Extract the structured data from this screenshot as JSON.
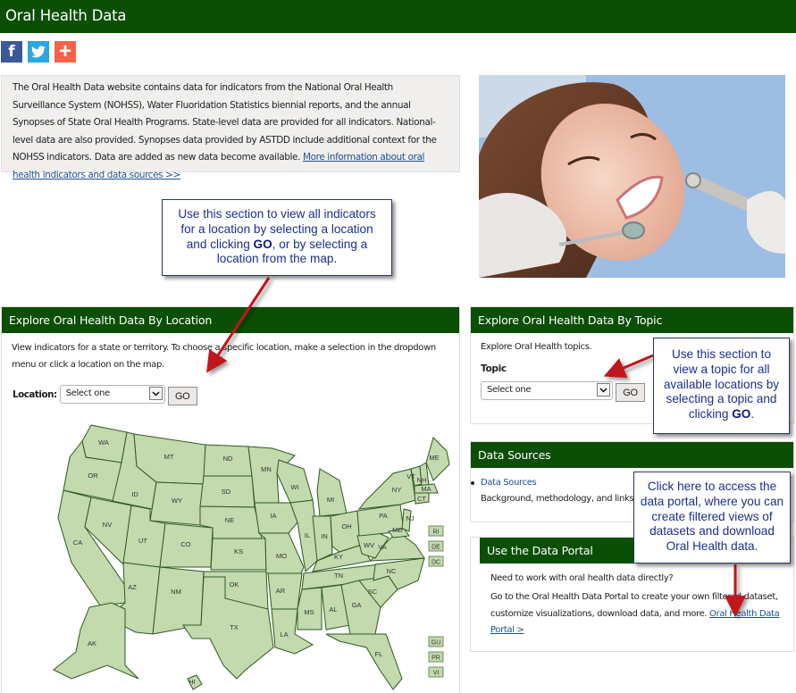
{
  "header": {
    "title": "Oral Health Data"
  },
  "social": [
    {
      "name": "facebook",
      "glyph": "f"
    },
    {
      "name": "twitter",
      "glyph": ""
    },
    {
      "name": "addthis",
      "glyph": "+"
    }
  ],
  "intro": {
    "text": "The Oral Health Data website contains data for indicators from the National Oral Health Surveillance System (NOHSS), Water Fluoridation Statistics biennial reports, and the annual Synopses of State Oral Health Programs. State-level data are provided for all indicators. National-level data are also provided. Synopses data provided by ASTDD include additional context for the NOHSS indicators. Data are added as new data become available. ",
    "link": "More information about oral health indicators and data sources >>"
  },
  "hero_image": {
    "alt": "Smiling patient in dental chair"
  },
  "location_panel": {
    "title": "Explore Oral Health Data By Location",
    "description": "View indicators for a state or territory. To choose a specific location, make a selection in the dropdown menu or click a location on the map.",
    "field_label": "Location:",
    "select_value": "Select one",
    "go_label": "GO"
  },
  "map": {
    "states": [
      "WA",
      "OR",
      "CA",
      "ID",
      "NV",
      "MT",
      "WY",
      "UT",
      "AZ",
      "CO",
      "NM",
      "ND",
      "SD",
      "NE",
      "KS",
      "OK",
      "TX",
      "MN",
      "IA",
      "MO",
      "AR",
      "LA",
      "WI",
      "IL",
      "MI",
      "IN",
      "OH",
      "KY",
      "TN",
      "MS",
      "AL",
      "GA",
      "FL",
      "SC",
      "NC",
      "VA",
      "WV",
      "PA",
      "NY",
      "VT",
      "NH",
      "ME",
      "MA",
      "CT",
      "NJ",
      "MD",
      "AK",
      "HI"
    ],
    "side_boxes_top": [
      "RI",
      "DE",
      "DC"
    ],
    "side_boxes_bottom": [
      "GU",
      "PR",
      "VI"
    ]
  },
  "topic_panel": {
    "title": "Explore Oral Health Data By Topic",
    "description": "Explore Oral Health topics.",
    "field_label": "Topic",
    "select_value": "Select one",
    "go_label": "GO"
  },
  "sources_panel": {
    "title": "Data Sources",
    "link": "Data Sources",
    "description": "Background, methodology, and links t"
  },
  "portal_panel": {
    "title": "Use the Data Portal",
    "question": "Need to work with oral health data directly?",
    "text": "Go to the Oral Health Data Portal to create your own filtered dataset, customize visualizations, download data, and more. ",
    "link": "Oral Health Data Portal >"
  },
  "callouts": {
    "location": {
      "pre": "Use this section to view all indicators for a location by selecting a location and clicking ",
      "bold": "GO",
      "post": ", or by selecting a location from the map."
    },
    "topic": {
      "pre": "Use this section to view a topic for all available locations by selecting a topic and clicking ",
      "bold": "GO",
      "post": "."
    },
    "portal": {
      "text": "Click here to access the data portal, where you can create filtered views of datasets and download Oral Health data."
    }
  },
  "colors": {
    "brand_green": "#0b4f06",
    "map_fill": "#c3d9ae",
    "map_stroke": "#2e5a1f",
    "callout_text": "#1c2f8f",
    "arrow": "#c0141b"
  }
}
